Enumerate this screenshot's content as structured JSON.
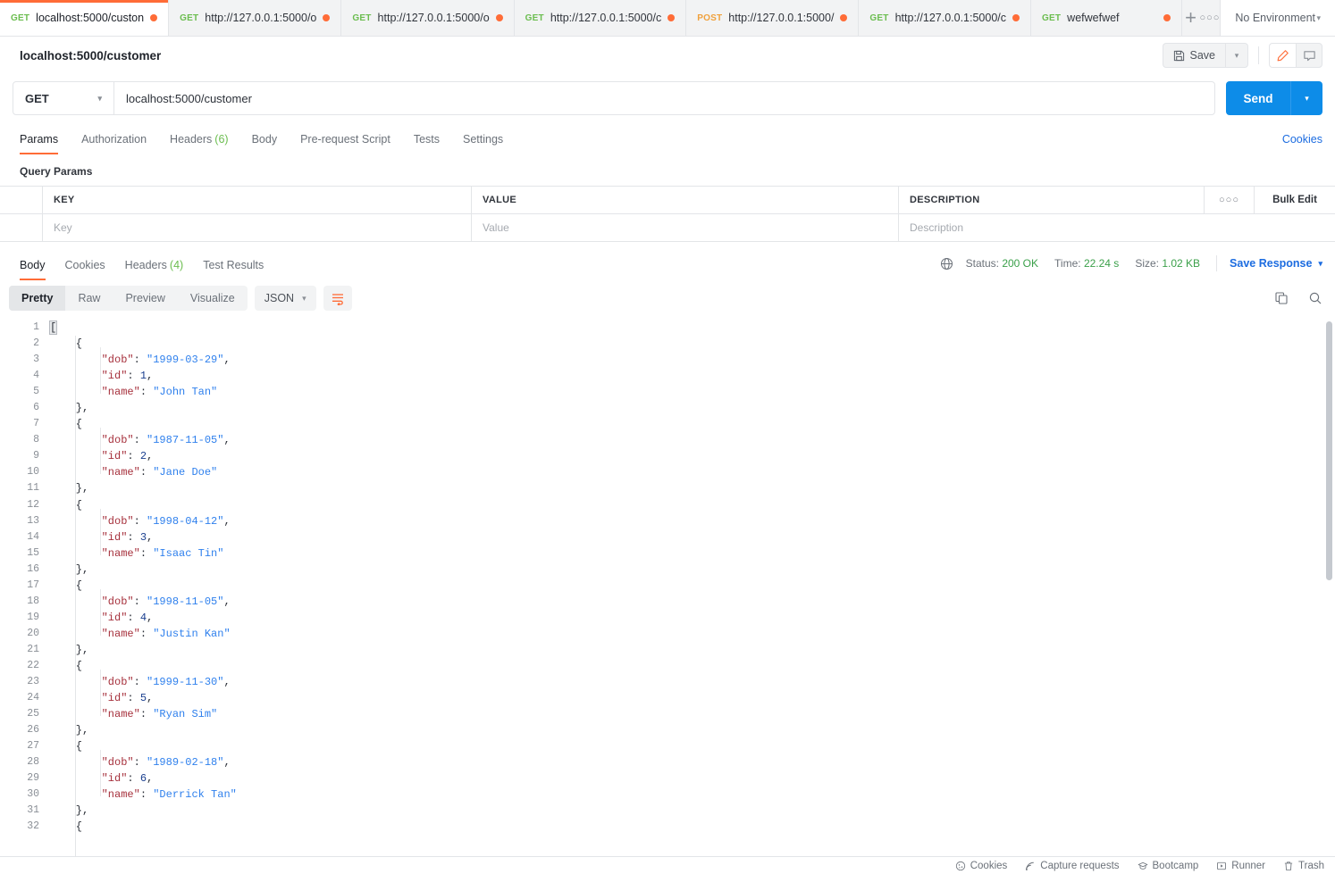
{
  "tabbar": {
    "tabs": [
      {
        "method": "GET",
        "name": "localhost:5000/custon",
        "active": true,
        "unsaved": true
      },
      {
        "method": "GET",
        "name": "http://127.0.0.1:5000/o",
        "active": false,
        "unsaved": true
      },
      {
        "method": "GET",
        "name": "http://127.0.0.1:5000/o",
        "active": false,
        "unsaved": true
      },
      {
        "method": "GET",
        "name": "http://127.0.0.1:5000/c",
        "active": false,
        "unsaved": true
      },
      {
        "method": "POST",
        "name": "http://127.0.0.1:5000/",
        "active": false,
        "unsaved": true
      },
      {
        "method": "GET",
        "name": "http://127.0.0.1:5000/c",
        "active": false,
        "unsaved": true
      },
      {
        "method": "GET",
        "name": "wefwefwef",
        "active": false,
        "unsaved": true
      }
    ],
    "new_tab_label": "+",
    "more_label": "○○○",
    "environment": "No Environment"
  },
  "request_header": {
    "title": "localhost:5000/customer",
    "save_label": "Save",
    "save_caret": "⌄",
    "edit_icon": "pencil-icon",
    "comment_icon": "comment-icon"
  },
  "urlbar": {
    "method": "GET",
    "url": "localhost:5000/customer",
    "send_label": "Send"
  },
  "request_tabs": {
    "items": [
      {
        "label": "Params",
        "count": "",
        "active": true
      },
      {
        "label": "Authorization",
        "count": "",
        "active": false
      },
      {
        "label": "Headers",
        "count": "(6)",
        "active": false
      },
      {
        "label": "Body",
        "count": "",
        "active": false
      },
      {
        "label": "Pre-request Script",
        "count": "",
        "active": false
      },
      {
        "label": "Tests",
        "count": "",
        "active": false
      },
      {
        "label": "Settings",
        "count": "",
        "active": false
      }
    ],
    "cookies_label": "Cookies"
  },
  "params": {
    "section_label": "Query Params",
    "columns": [
      "KEY",
      "VALUE",
      "DESCRIPTION"
    ],
    "more_label": "○○○",
    "bulk_edit_label": "Bulk Edit",
    "placeholders": {
      "key": "Key",
      "value": "Value",
      "description": "Description"
    }
  },
  "response": {
    "tabs": [
      {
        "label": "Body",
        "count": "",
        "active": true
      },
      {
        "label": "Cookies",
        "count": "",
        "active": false
      },
      {
        "label": "Headers",
        "count": "(4)",
        "active": false
      },
      {
        "label": "Test Results",
        "count": "",
        "active": false
      }
    ],
    "globe_icon": "globe-icon",
    "status_label": "Status:",
    "status_value": "200 OK",
    "time_label": "Time:",
    "time_value": "22.24 s",
    "size_label": "Size:",
    "size_value": "1.02 KB",
    "save_response_label": "Save Response",
    "save_response_caret": "⌄",
    "view_modes": [
      {
        "label": "Pretty",
        "active": true
      },
      {
        "label": "Raw",
        "active": false
      },
      {
        "label": "Preview",
        "active": false
      },
      {
        "label": "Visualize",
        "active": false
      }
    ],
    "format": "JSON",
    "format_caret": "⌄",
    "wrap_icon": "wrap-lines-icon",
    "copy_icon": "copy-icon",
    "search_icon": "search-icon"
  },
  "body_json": [
    {
      "id": 1,
      "dob": "1999-03-29",
      "name": "John Tan"
    },
    {
      "id": 2,
      "dob": "1987-11-05",
      "name": "Jane Doe"
    },
    {
      "id": 3,
      "dob": "1998-04-12",
      "name": "Isaac Tin"
    },
    {
      "id": 4,
      "dob": "1998-11-05",
      "name": "Justin Kan"
    },
    {
      "id": 5,
      "dob": "1999-11-30",
      "name": "Ryan Sim"
    },
    {
      "id": 6,
      "dob": "1989-02-18",
      "name": "Derrick Tan"
    }
  ],
  "body_first_line": "[",
  "body_last_visible_line": "{",
  "footer": {
    "items": [
      {
        "label": "Cookies",
        "icon": "cookie-icon"
      },
      {
        "label": "Capture requests",
        "icon": "satellite-icon"
      },
      {
        "label": "Bootcamp",
        "icon": "bootcamp-icon"
      },
      {
        "label": "Runner",
        "icon": "runner-icon"
      },
      {
        "label": "Trash",
        "icon": "trash-icon"
      }
    ]
  },
  "colors": {
    "accent_orange": "#ff6c37",
    "send_blue": "#0d8ce8",
    "link_blue": "#1c6ce0",
    "status_green": "#3ba04a",
    "method_get": "#6bbd4f",
    "method_post": "#f0a13c"
  }
}
